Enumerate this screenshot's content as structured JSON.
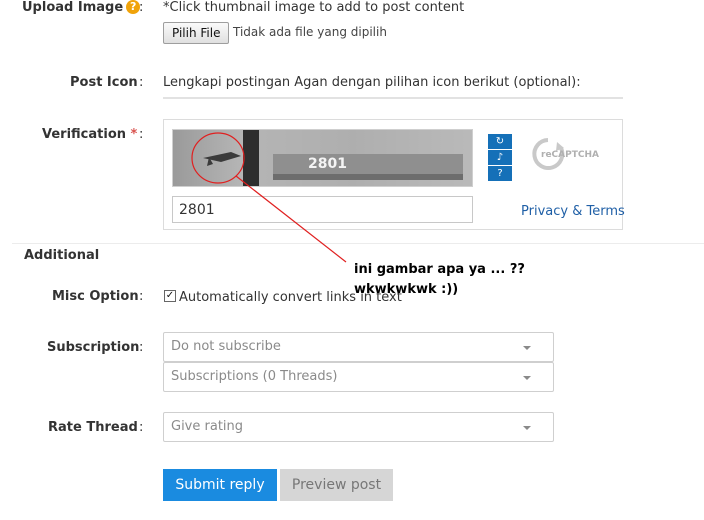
{
  "upload": {
    "label": "Upload Image",
    "help": "?",
    "colon": ":",
    "hint": "*Click thumbnail image to add to post content",
    "button_label": "Pilih File",
    "no_file_text": "Tidak ada file yang dipilih"
  },
  "post_icon": {
    "label": "Post Icon",
    "colon": ":",
    "text": "Lengkapi postingan Agan dengan pilihan icon berikut (optional):"
  },
  "verification": {
    "label": "Verification",
    "required_mark": "*",
    "colon": ":",
    "captcha_image_text": "2801",
    "input_value": "2801",
    "recaptcha_logo_text": "reCAPTCHA",
    "privacy_terms": "Privacy & Terms"
  },
  "additional": {
    "section_title": "Additional"
  },
  "misc_option": {
    "label": "Misc Option",
    "colon": ":",
    "checkbox_checked": true,
    "checkbox_mark": "✓",
    "checkbox_label": "Automatically convert links in text"
  },
  "subscription": {
    "label": "Subscription",
    "colon": ":",
    "select1_value": "Do not subscribe",
    "select2_value": "Subscriptions (0 Threads)"
  },
  "rate_thread": {
    "label": "Rate Thread",
    "colon": ":",
    "select_value": "Give rating"
  },
  "buttons": {
    "submit_label": "Submit reply",
    "preview_label": "Preview post"
  },
  "annotation": {
    "line1": "ini gambar apa ya ... ??",
    "line2": "wkwkwkwk :))"
  },
  "colors": {
    "accent": "#1a8be0",
    "required": "#d9534f",
    "annotation": "#e02020",
    "recaptcha_blue": "#1570b8"
  }
}
